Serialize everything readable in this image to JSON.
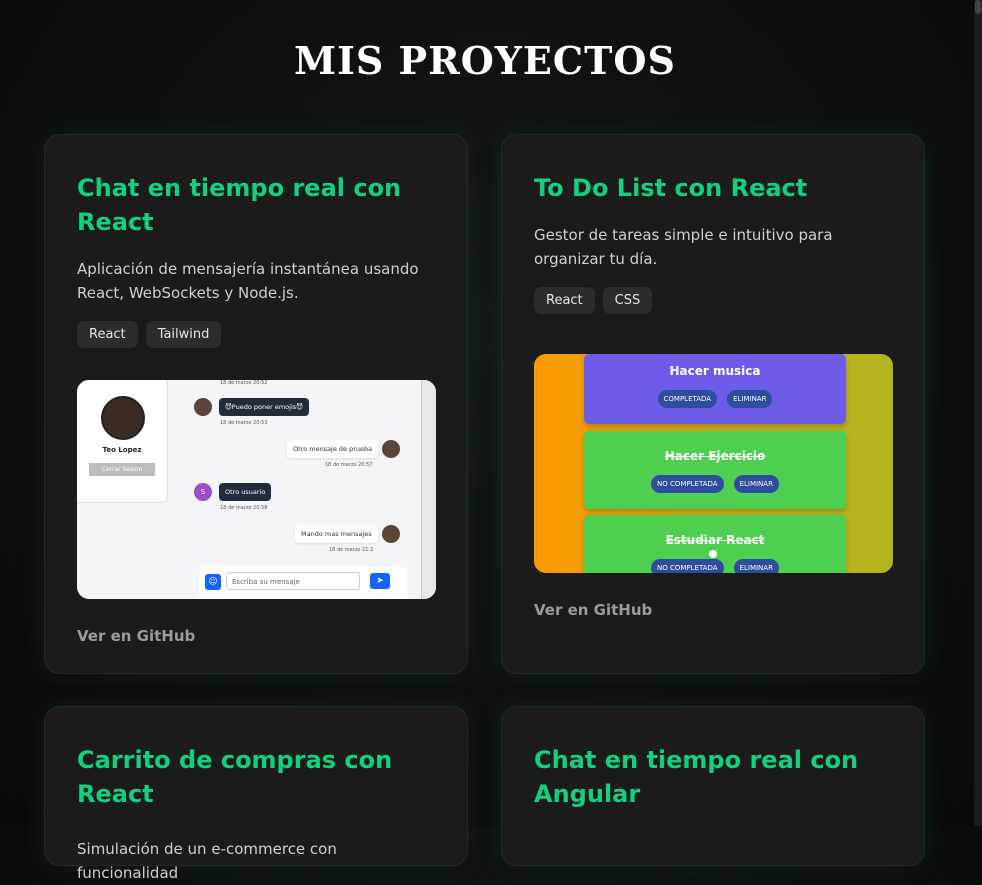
{
  "page": {
    "title": "MIS PROYECTOS"
  },
  "projects": [
    {
      "title": "Chat en tiempo real con React",
      "description": "Aplicación de mensajería instantánea usando React, WebSockets y Node.js.",
      "tags": [
        "React",
        "Tailwind"
      ],
      "link": "Ver en GitHub",
      "preview": {
        "user_name": "Teo Lopez",
        "logout_label": "Cerrar Sesion",
        "messages": [
          {
            "text": "😈Puedo poner emojis😈",
            "time": "18 de marzo 20:53",
            "side": "left"
          },
          {
            "text": "Otro mensaje de prueba",
            "time": "18 de marzo 20:57",
            "side": "right"
          },
          {
            "text": "Otro usuario",
            "time": "18 de marzo 20:58",
            "side": "left",
            "initial": "S"
          },
          {
            "text": "Mando mas mensajes",
            "time": "18 de marzo 21:2",
            "side": "right"
          }
        ],
        "top_time": "18 de marzo 20:52",
        "input_placeholder": "Escriba su mensaje"
      }
    },
    {
      "title": "To Do List con React",
      "description": "Gestor de tareas simple e intuitivo para organizar tu día.",
      "tags": [
        "React",
        "CSS"
      ],
      "link": "Ver en GitHub",
      "preview": {
        "tasks": [
          {
            "title": "Hacer musica",
            "status_btn": "COMPLETADA",
            "delete_btn": "ELIMINAR",
            "color": "#6c5ce7",
            "done": false
          },
          {
            "title": "Hacer Ejercicio",
            "status_btn": "NO COMPLETADA",
            "delete_btn": "ELIMINAR",
            "color": "#4fcf4f",
            "done": true
          },
          {
            "title": "Estudiar React",
            "status_btn": "NO COMPLETADA",
            "delete_btn": "ELIMINAR",
            "color": "#4fcf4f",
            "done": true
          }
        ]
      }
    },
    {
      "title": "Carrito de compras con React",
      "description": "Simulación de un e-commerce con funcionalidad"
    },
    {
      "title": "Chat en tiempo real con Angular"
    }
  ],
  "colors": {
    "accent": "#10d17e",
    "card_bg": "#1b1b1b",
    "page_bg": "#0d0f0e"
  }
}
